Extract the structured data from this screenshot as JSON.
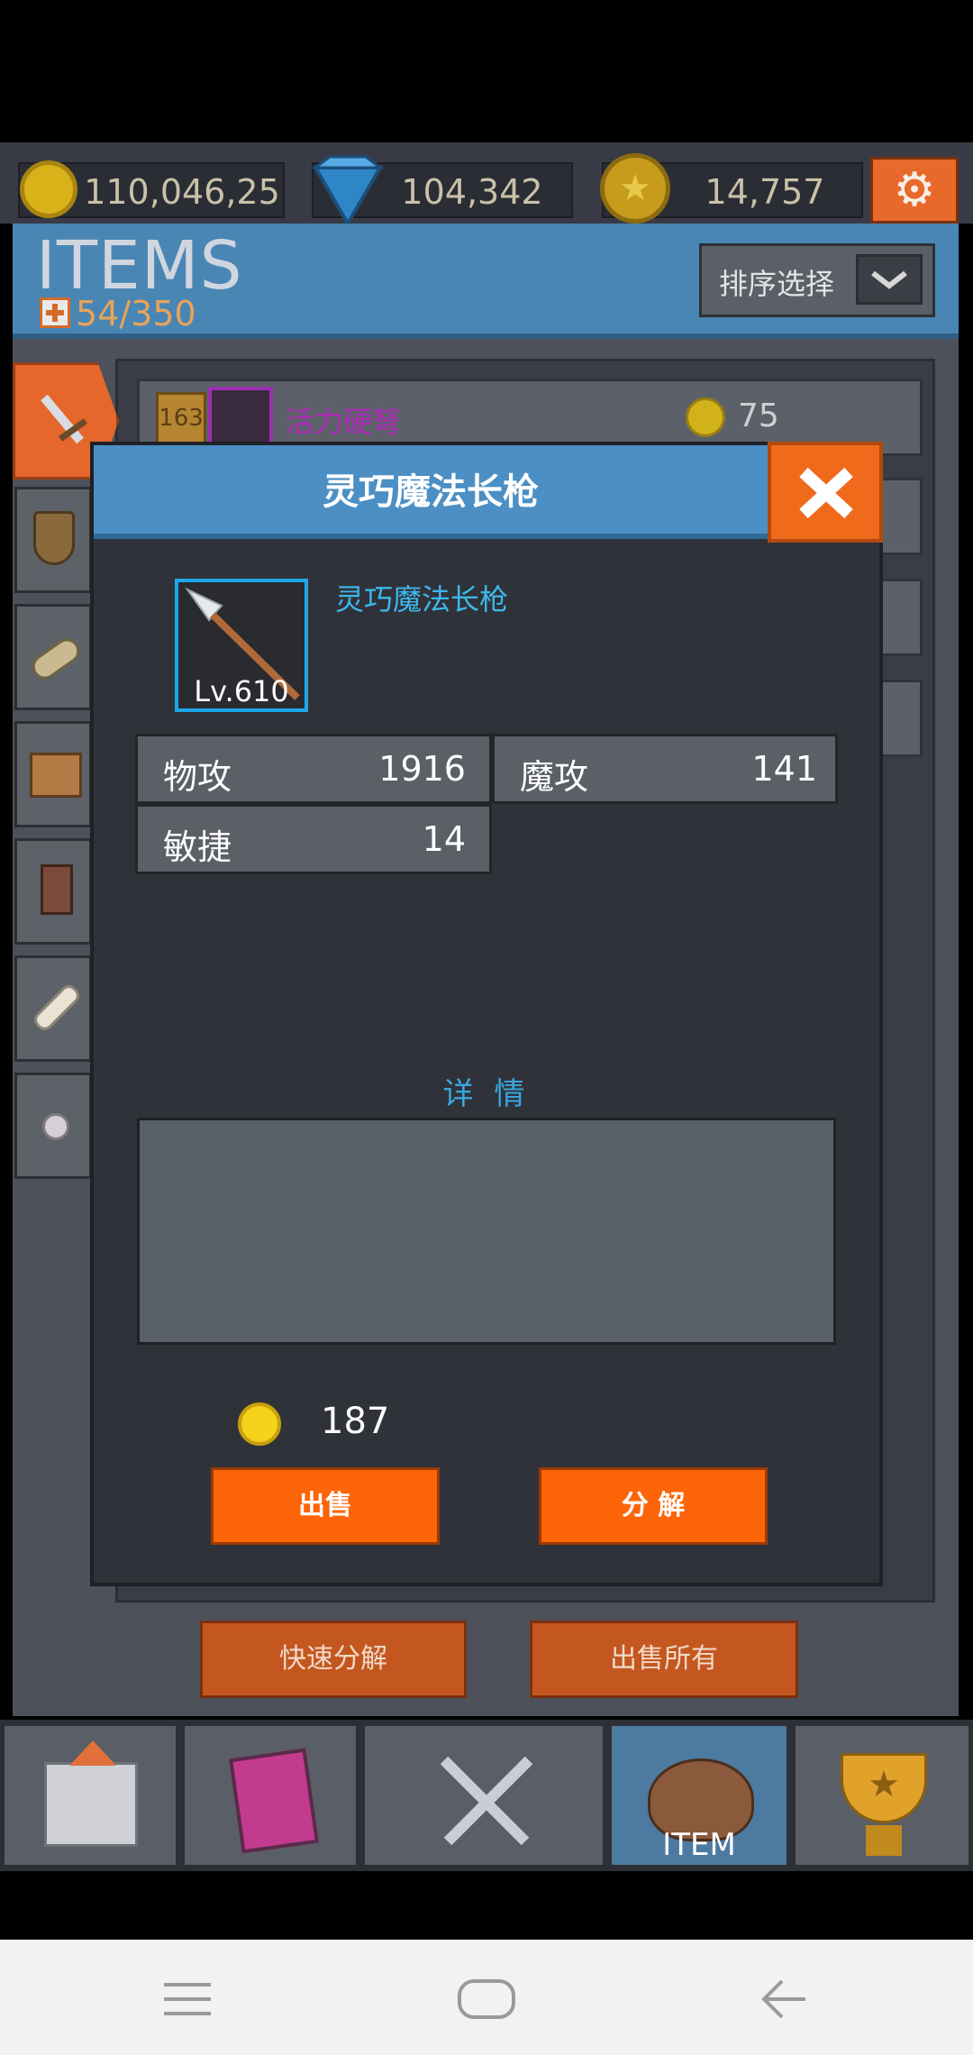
{
  "currencies": [
    {
      "id": "gold",
      "value": "110,046,25"
    },
    {
      "id": "gem",
      "value": "104,342"
    },
    {
      "id": "medal",
      "value": "14,757"
    }
  ],
  "header": {
    "title": "ITEMS",
    "capacity": "54/350",
    "sort_label": "排序选择"
  },
  "list": {
    "first_item_level": "163",
    "first_item_name": "活力硬弩",
    "first_item_price": "75"
  },
  "footer_buttons": {
    "quick_decompose": "快速分解",
    "sell_all": "出售所有"
  },
  "nav": [
    {
      "label": "ITEM"
    }
  ],
  "modal": {
    "title": "灵巧魔法长枪",
    "item_name": "灵巧魔法长枪",
    "level": "Lv.610",
    "stats": [
      {
        "label": "物攻",
        "value": "1916"
      },
      {
        "label": "魔攻",
        "value": "141"
      },
      {
        "label": "敏捷",
        "value": "14"
      }
    ],
    "details_label": "详 情",
    "price": "187",
    "sell_label": "出售",
    "decompose_label": "分 解"
  },
  "colors": {
    "accent": "#fd6508",
    "header_blue": "#4b8fc4",
    "name_blue": "#3cb9ec"
  }
}
